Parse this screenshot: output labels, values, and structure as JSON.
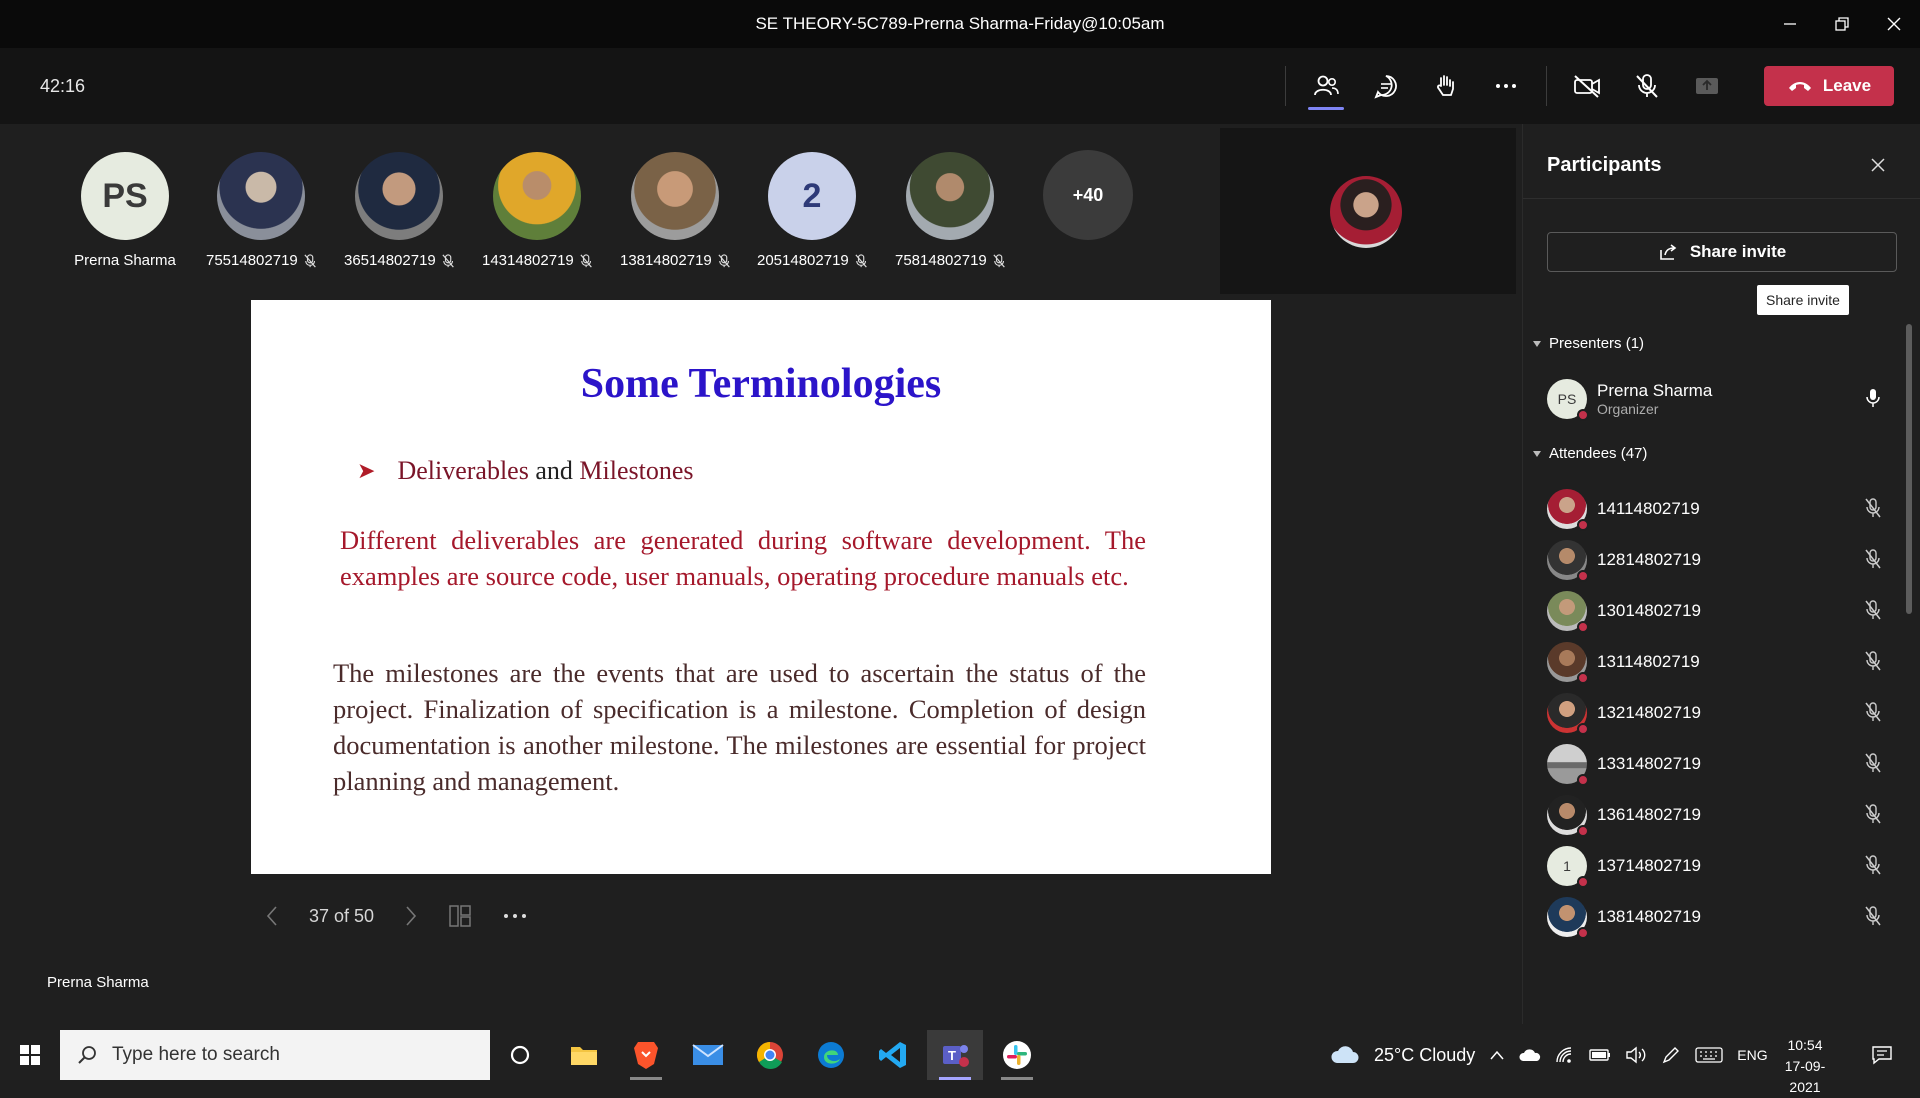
{
  "window": {
    "title": "SE THEORY-5C789-Prerna Sharma-Friday@10:05am"
  },
  "toolbar": {
    "timer": "42:16",
    "leave_label": "Leave"
  },
  "strip": {
    "participants": [
      {
        "name": "Prerna Sharma",
        "initials": "PS",
        "muted": false
      },
      {
        "name": "75514802719",
        "muted": true
      },
      {
        "name": "36514802719",
        "muted": true
      },
      {
        "name": "14314802719",
        "muted": true
      },
      {
        "name": "13814802719",
        "muted": true
      },
      {
        "name": "20514802719",
        "initials": "2",
        "muted": true
      },
      {
        "name": "75814802719",
        "muted": true
      }
    ],
    "more_count": "+40"
  },
  "slide": {
    "title": "Some Terminologies",
    "bullet_part1": "Deliverables",
    "bullet_and": "and",
    "bullet_part2": "Milestones",
    "para1": "Different deliverables are generated during software development. The examples are source code, user manuals, operating procedure manuals etc.",
    "para2": "The milestones are the events that are used to ascertain the status of the project. Finalization of specification is a milestone. Completion of design documentation is another milestone. The milestones are essential for project planning and management."
  },
  "slide_nav": {
    "page": "37 of 50"
  },
  "presenter_label": "Prerna Sharma",
  "panel": {
    "title": "Participants",
    "share_label": "Share invite",
    "tooltip": "Share invite",
    "presenters_heading": "Presenters (1)",
    "presenter": {
      "name": "Prerna Sharma",
      "role": "Organizer",
      "initials": "PS"
    },
    "attendees_heading": "Attendees (47)",
    "attendees": [
      {
        "name": "14114802719"
      },
      {
        "name": "12814802719"
      },
      {
        "name": "13014802719"
      },
      {
        "name": "13114802719"
      },
      {
        "name": "13214802719"
      },
      {
        "name": "13314802719"
      },
      {
        "name": "13614802719"
      },
      {
        "name": "13714802719",
        "initials": "1"
      },
      {
        "name": "13814802719"
      }
    ]
  },
  "taskbar": {
    "search_placeholder": "Type here to search",
    "weather": "25°C  Cloudy",
    "language": "ENG",
    "time": "10:54",
    "date": "17-09-2021"
  },
  "colors": {
    "accent": "#7f85f5",
    "leave": "#c4314b",
    "slide_title": "#2b14c9",
    "slide_red": "#a5182b"
  }
}
